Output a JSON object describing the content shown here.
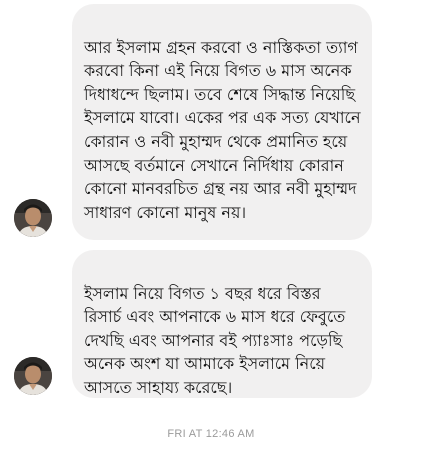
{
  "messages": [
    {
      "sender": "other",
      "text": "আর ইসলাম গ্রহন করবো ও নাস্তিকতা ত্যাগ করবো কিনা এই নিয়ে বিগত ৬ মাস অনেক দিধাধন্দে ছিলাম। তবে শেষে সিদ্ধান্ত নিয়েছি ইসলামে যাবো। একের পর এক সত্য যেখানে কোরান ও নবী মুহাম্মদ থেকে প্রমানিত হয়ে আসছে বর্তমানে সেখানে নির্দিধায় কোরান কোনো মানবরচিত গ্রন্থ নয় আর নবী মুহাম্মদ সাধারণ কোনো মানুষ নয়।"
    },
    {
      "sender": "other",
      "text": "ইসলাম নিয়ে বিগত ১ বছর ধরে বিস্তর রিসার্চ এবং আপনাকে ৬ মাস ধরে ফেবুতে দেখছি এবং আপনার বই প্যাঃসাঃ পড়েছি অনেক অংশ যা আমাকে ইসলামে নিয়ে আসতে সাহায্য করেছে।"
    }
  ],
  "timestamp": "FRI AT 12:46 AM",
  "colors": {
    "bubble": "#f1f0f0",
    "text": "#111111",
    "timestamp": "#9a9a9a"
  }
}
